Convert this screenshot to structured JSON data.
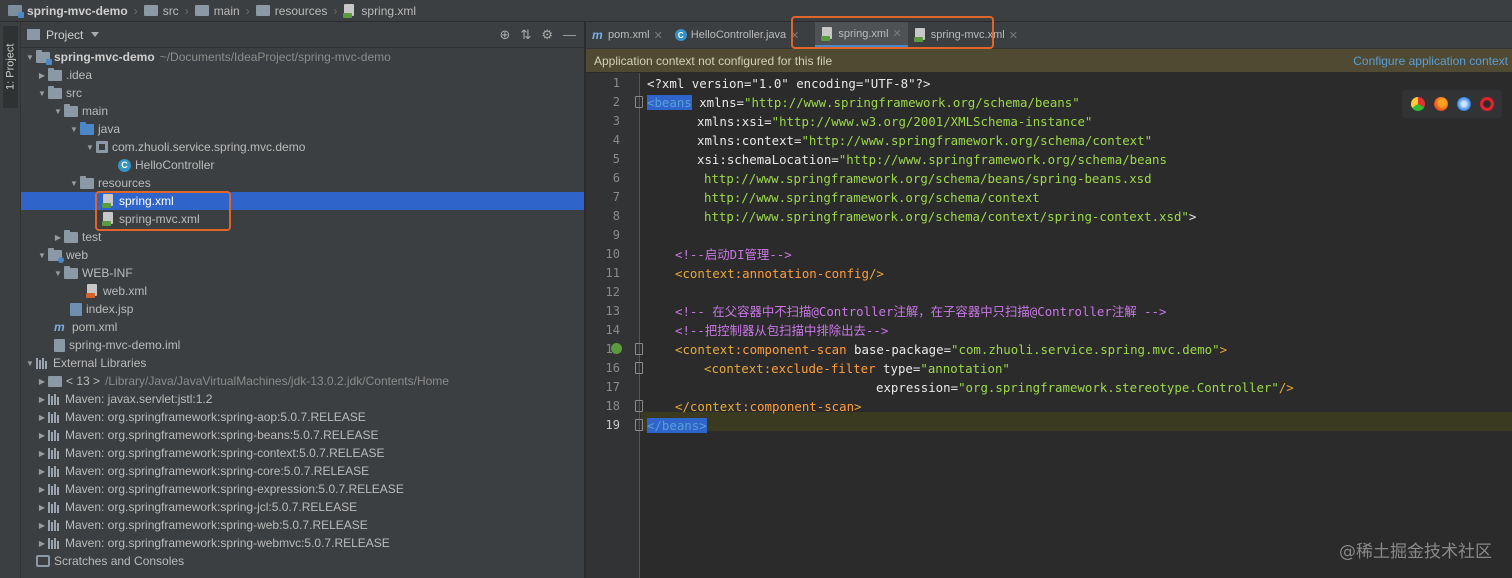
{
  "nav": {
    "items": [
      "spring-mvc-demo",
      "src",
      "main",
      "resources",
      "spring.xml"
    ]
  },
  "sidebar": {
    "tool_window_label": "1: Project"
  },
  "project_panel": {
    "title": "Project",
    "tree": [
      {
        "label": "spring-mvc-demo",
        "path": "~/Documents/IdeaProject/spring-mvc-demo"
      },
      {
        "label": ".idea"
      },
      {
        "label": "src"
      },
      {
        "label": "main"
      },
      {
        "label": "java"
      },
      {
        "label": "com.zhuoli.service.spring.mvc.demo"
      },
      {
        "label": "HelloController"
      },
      {
        "label": "resources"
      },
      {
        "label": "spring.xml"
      },
      {
        "label": "spring-mvc.xml"
      },
      {
        "label": "test"
      },
      {
        "label": "web"
      },
      {
        "label": "WEB-INF"
      },
      {
        "label": "web.xml"
      },
      {
        "label": "index.jsp"
      },
      {
        "label": "pom.xml"
      },
      {
        "label": "spring-mvc-demo.iml"
      },
      {
        "label": "External Libraries"
      },
      {
        "label": "< 13 >",
        "path": "/Library/Java/JavaVirtualMachines/jdk-13.0.2.jdk/Contents/Home"
      },
      {
        "label": "Maven: javax.servlet:jstl:1.2"
      },
      {
        "label": "Maven: org.springframework:spring-aop:5.0.7.RELEASE"
      },
      {
        "label": "Maven: org.springframework:spring-beans:5.0.7.RELEASE"
      },
      {
        "label": "Maven: org.springframework:spring-context:5.0.7.RELEASE"
      },
      {
        "label": "Maven: org.springframework:spring-core:5.0.7.RELEASE"
      },
      {
        "label": "Maven: org.springframework:spring-expression:5.0.7.RELEASE"
      },
      {
        "label": "Maven: org.springframework:spring-jcl:5.0.7.RELEASE"
      },
      {
        "label": "Maven: org.springframework:spring-web:5.0.7.RELEASE"
      },
      {
        "label": "Maven: org.springframework:spring-webmvc:5.0.7.RELEASE"
      },
      {
        "label": "Scratches and Consoles"
      }
    ]
  },
  "tabs": [
    "pom.xml",
    "HelloController.java",
    "spring.xml",
    "spring-mvc.xml"
  ],
  "banner": {
    "message": "Application context not configured for this file",
    "action": "Configure application context"
  },
  "editor": {
    "line_numbers": [
      "1",
      "2",
      "3",
      "4",
      "5",
      "6",
      "7",
      "8",
      "9",
      "10",
      "11",
      "12",
      "13",
      "14",
      "15",
      "16",
      "17",
      "18",
      "19"
    ],
    "current_line": 19,
    "code": {
      "l1": "<?xml version=\"1.0\" encoding=\"UTF-8\"?>",
      "l2_tag": "<beans",
      "l2_attr": " xmlns=",
      "l2_val": "\"http://www.springframework.org/schema/beans\"",
      "l3_ns": "xmlns",
      "l3_attr": ":xsi=",
      "l3_val": "\"http://www.w3.org/2001/XMLSchema-instance\"",
      "l4_ns": "xmlns",
      "l4_attr": ":context=",
      "l4_val": "\"http://www.springframework.org/schema/context\"",
      "l5_ns": "xsi",
      "l5_attr": ":schemaLocation=",
      "l5_val": "\"http://www.springframework.org/schema/beans",
      "l6": "http://www.springframework.org/schema/beans/spring-beans.xsd",
      "l7": "http://www.springframework.org/schema/context",
      "l8_val": "http://www.springframework.org/schema/context/spring-context.xsd\"",
      "l8_end": ">",
      "l10": "<!--启动DI管理-->",
      "l11_a": "<context",
      "l11_b": ":annotation-config",
      "l11_c": "/>",
      "l13": "<!-- 在父容器中不扫描@Controller注解，在子容器中只扫描@Controller注解 -->",
      "l14": "<!--把控制器从包扫描中排除出去-->",
      "l15_a": "<context",
      "l15_b": ":component-scan",
      "l15_c": " base-package=",
      "l15_d": "\"com.zhuoli.service.spring.mvc.demo\"",
      "l15_e": ">",
      "l16_a": "<context",
      "l16_b": ":exclude-filter",
      "l16_c": " type=",
      "l16_d": "\"annotation\"",
      "l17_c": "expression=",
      "l17_d": "\"org.springframework.stereotype.Controller\"",
      "l17_e": "/>",
      "l18_a": "</context",
      "l18_b": ":component-scan",
      "l18_c": ">",
      "l19": "</beans>"
    }
  },
  "browser_icons": [
    "chrome-icon",
    "firefox-icon",
    "safari-icon",
    "opera-icon"
  ],
  "watermark": "@稀土掘金技术社区",
  "colors": {
    "highlight_box": "#e0652a",
    "selection": "#2f65ca",
    "link": "#5a9ed9"
  }
}
